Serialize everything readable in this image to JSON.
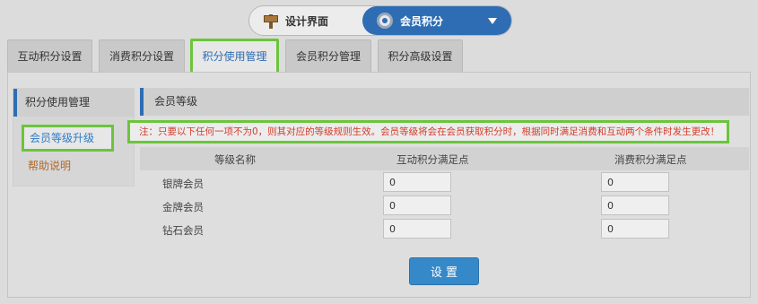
{
  "switcher": {
    "left_label": "设计界面",
    "right_label": "会员积分",
    "left_icon": "signpost-icon",
    "right_icon": "gear-icon",
    "active_color": "#2e6db3"
  },
  "tabs": [
    {
      "label": "互动积分设置",
      "active": false
    },
    {
      "label": "消费积分设置",
      "active": false
    },
    {
      "label": "积分使用管理",
      "active": true
    },
    {
      "label": "会员积分管理",
      "active": false
    },
    {
      "label": "积分高级设置",
      "active": false
    }
  ],
  "sidebar": {
    "title": "积分使用管理",
    "items": [
      {
        "label": "会员等级升级",
        "active": true
      },
      {
        "label": "帮助说明",
        "active": false
      }
    ]
  },
  "content": {
    "title": "会员等级",
    "notice": "注：只要以下任何一项不为0，则其对应的等级规则生效。会员等级将会在会员获取积分时，根据同时满足消费和互动两个条件时发生更改！",
    "columns": [
      "等级名称",
      "互动积分满足点",
      "消费积分满足点"
    ],
    "rows": [
      {
        "name": "银牌会员",
        "interaction": "0",
        "consumption": "0"
      },
      {
        "name": "金牌会员",
        "interaction": "0",
        "consumption": "0"
      },
      {
        "name": "钻石会员",
        "interaction": "0",
        "consumption": "0"
      }
    ],
    "submit_label": "设 置"
  },
  "colors": {
    "highlight_border": "#6cc43d",
    "notice_text": "#d43a2a",
    "button": "#3689c9"
  }
}
